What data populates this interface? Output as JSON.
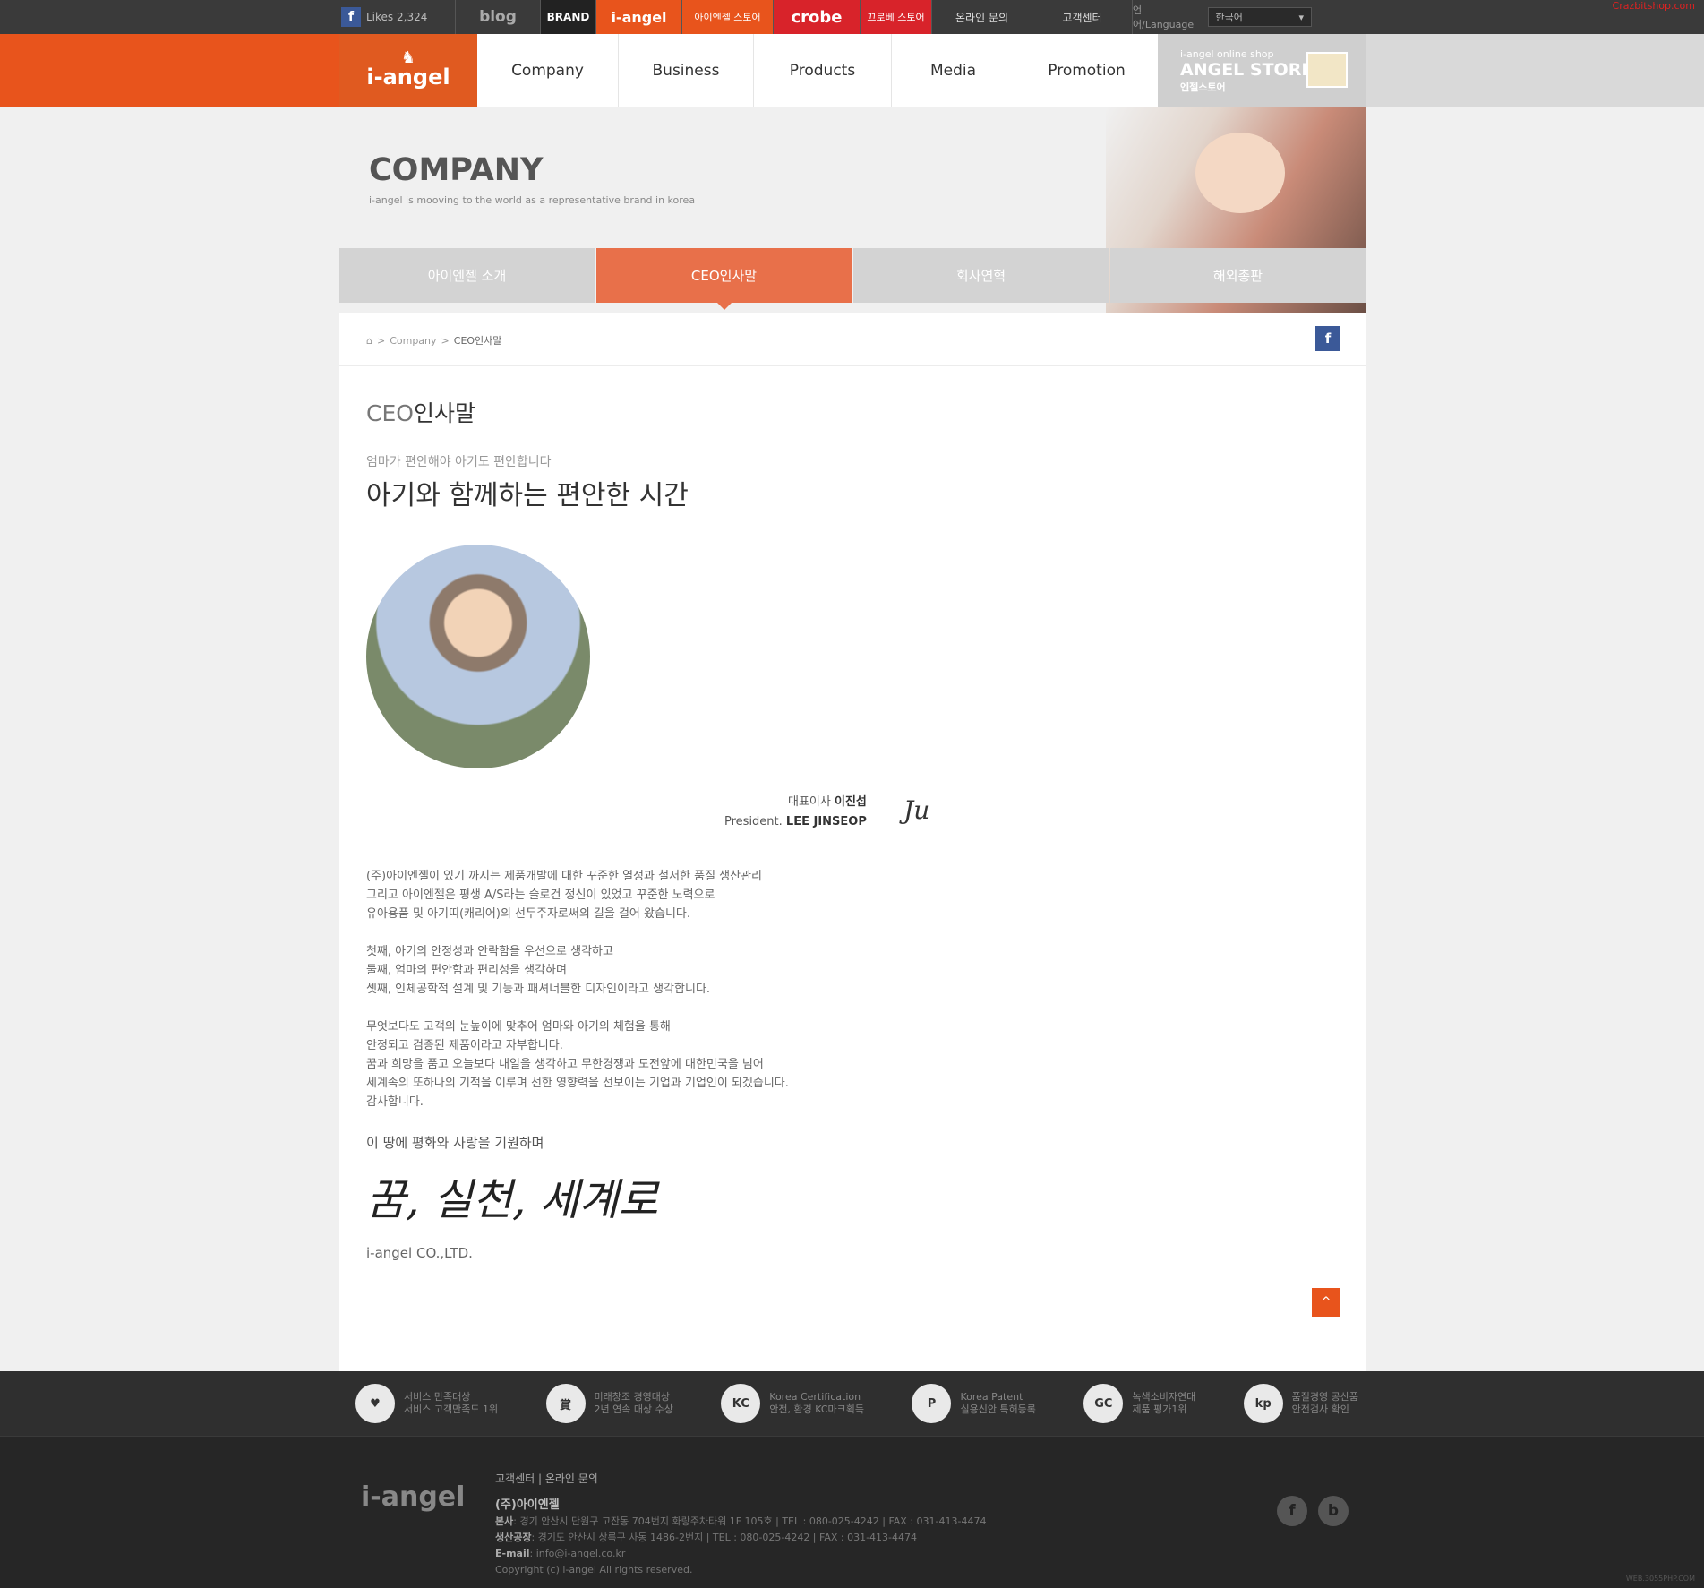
{
  "topbar": {
    "fb_icon": "f",
    "likes": "Likes 2,324",
    "blog": "blog",
    "brand": "BRAND",
    "iangel": "i-angel",
    "iangel_store": "아이엔젤 스토어",
    "crobe": "crobe",
    "crobe_store": "끄로베 스토어",
    "inquiry": "온라인 문의",
    "support": "고객센터",
    "lang_label": "언어/Language",
    "lang_value": "한국어",
    "corner_text": "Crazbitshop.com"
  },
  "header": {
    "logo": "i-angel",
    "nav": [
      "Company",
      "Business",
      "Products",
      "Media",
      "Promotion"
    ],
    "store_line1": "i-angel online shop",
    "store_line2": "ANGEL STORE",
    "store_line3": "엔젤스토어"
  },
  "hero": {
    "title": "COMPANY",
    "subtitle": "i-angel is mooving to the world as a representative brand in korea"
  },
  "subtabs": [
    "아이엔젤 소개",
    "CEO인사말",
    "회사연혁",
    "해외총판"
  ],
  "breadcrumb": {
    "home_icon": "⌂",
    "sep": ">",
    "level1": "Company",
    "current": "CEO인사말"
  },
  "page": {
    "title_prefix": "CEO",
    "title_suffix": "인사말",
    "tag_small": "엄마가 편안해야 아기도 편안합니다",
    "tag_big": "아기와 함께하는 편안한 시간",
    "sig_role": "대표이사",
    "sig_name_kr": "이진섭",
    "sig_title_en": "President.",
    "sig_name_en": "LEE JINSEOP",
    "sig_mark": "Ju",
    "para1": [
      "(주)아이엔젤이 있기 까지는 제품개발에 대한 꾸준한 열정과 철저한 품질 생산관리",
      "그리고 아이엔젤은 평생 A/S라는 슬로건 정신이 있었고 꾸준한 노력으로",
      "유아용품 및 아기띠(캐리어)의 선두주자로써의 길을 걸어 왔습니다."
    ],
    "para2": [
      "첫째, 아기의 안정성과 안락함을 우선으로 생각하고",
      "둘째, 엄마의 편안함과 편리성을 생각하며",
      "셋째, 인체공학적 설계 및 기능과 패셔너블한 디자인이라고 생각합니다."
    ],
    "para3": [
      "무엇보다도 고객의 눈높이에 맞추어 엄마와 아기의 체험을 통해",
      "안정되고 검증된 제품이라고 자부합니다.",
      "꿈과 희망을 품고 오늘보다 내일을 생각하고 무한경쟁과 도전앞에 대한민국을 넘어",
      "세계속의 또하나의 기적을 이루며 선한 영향력을 선보이는 기업과 기업인이 되겠습니다.",
      "감사합니다."
    ],
    "prayer": "이 땅에 평화와 사랑을 기원하며",
    "motto": "꿈, 실천, 세계로",
    "company": "i-angel CO.,LTD.",
    "top_icon": "^"
  },
  "awards": [
    {
      "icon": "♥",
      "l1": "서비스 만족대상",
      "l2": "서비스 고객만족도 1위"
    },
    {
      "icon": "賞",
      "l1": "미래창조 경영대상",
      "l2": "2년 연속 대상 수상"
    },
    {
      "icon": "KC",
      "l1": "Korea Certification",
      "l2": "안전, 환경 KC마크획득"
    },
    {
      "icon": "P",
      "l1": "Korea Patent",
      "l2": "실용신안 특허등록"
    },
    {
      "icon": "GC",
      "l1": "녹색소비자연대",
      "l2": "제품 평가1위"
    },
    {
      "icon": "kp",
      "l1": "품질경영 공산품",
      "l2": "안전검사 확인"
    }
  ],
  "footer": {
    "logo": "i-angel",
    "links": "고객센터 | 온라인 문의",
    "company": "(주)아이엔젤",
    "hq_label": "본사",
    "hq": ": 경기 안산시 단원구 고잔동 704번지 화랑주차타워 1F 105호 | TEL : 080-025-4242 | FAX : 031-413-4474",
    "factory_label": "생산공장",
    "factory": ": 경기도 안산시 상록구 사동 1486-2번지 | TEL : 080-025-4242 | FAX : 031-413-4474",
    "email_label": "E-mail",
    "email": ": info@i-angel.co.kr",
    "copyright": "Copyright (c) i-angel All rights reserved.",
    "social": [
      "f",
      "b"
    ],
    "watermark": "WEB.3055PHP.COM"
  }
}
